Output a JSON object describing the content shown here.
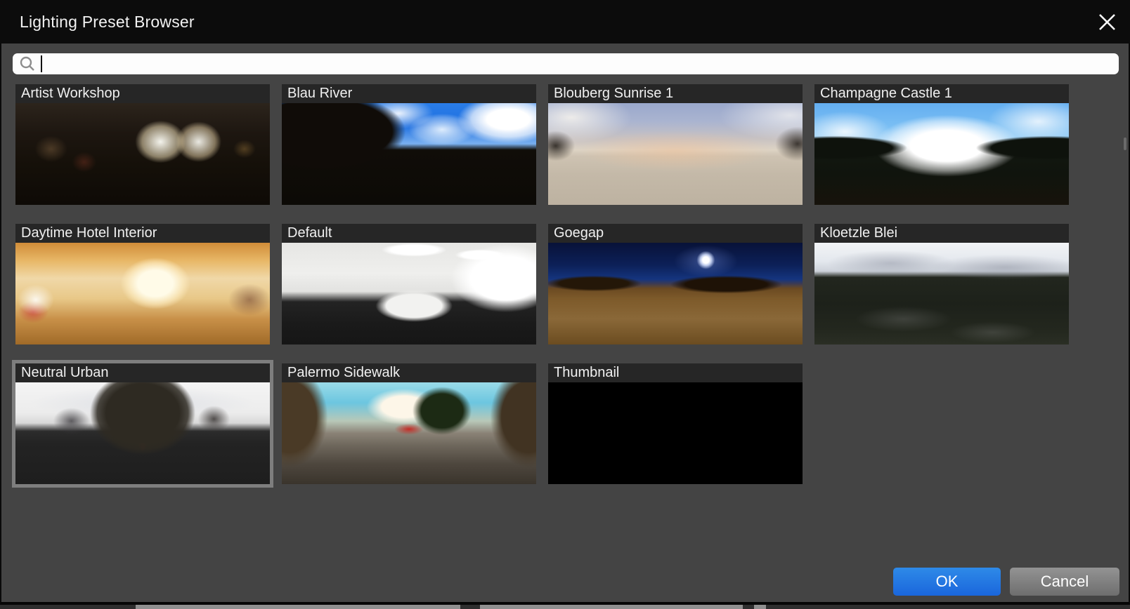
{
  "window": {
    "title": "Lighting Preset Browser"
  },
  "search": {
    "placeholder": "",
    "value": ""
  },
  "presets": [
    {
      "label": "Artist Workshop",
      "thumb": "artist-workshop",
      "selected": false
    },
    {
      "label": "Blau River",
      "thumb": "blau-river",
      "selected": false
    },
    {
      "label": "Blouberg Sunrise 1",
      "thumb": "blouberg-sunrise",
      "selected": false
    },
    {
      "label": "Champagne Castle 1",
      "thumb": "champagne-castle",
      "selected": false
    },
    {
      "label": "Daytime Hotel Interior",
      "thumb": "daytime-hotel",
      "selected": false
    },
    {
      "label": "Default",
      "thumb": "default-studio",
      "selected": false
    },
    {
      "label": "Goegap",
      "thumb": "goegap",
      "selected": false
    },
    {
      "label": "Kloetzle Blei",
      "thumb": "kloetzle-blei",
      "selected": false
    },
    {
      "label": "Neutral Urban",
      "thumb": "neutral-urban",
      "selected": true
    },
    {
      "label": "Palermo Sidewalk",
      "thumb": "palermo-sidewalk",
      "selected": false
    },
    {
      "label": "Thumbnail",
      "thumb": "black",
      "selected": false
    }
  ],
  "footer": {
    "ok": "OK",
    "cancel": "Cancel"
  },
  "colors": {
    "accent_blue": "#1f78e0",
    "titlebar": "#0c0c0c",
    "dialog_body": "#444444",
    "tile_header": "#262626",
    "selection_outline": "#7e7e7e",
    "search_field": "#fdfdfd"
  }
}
